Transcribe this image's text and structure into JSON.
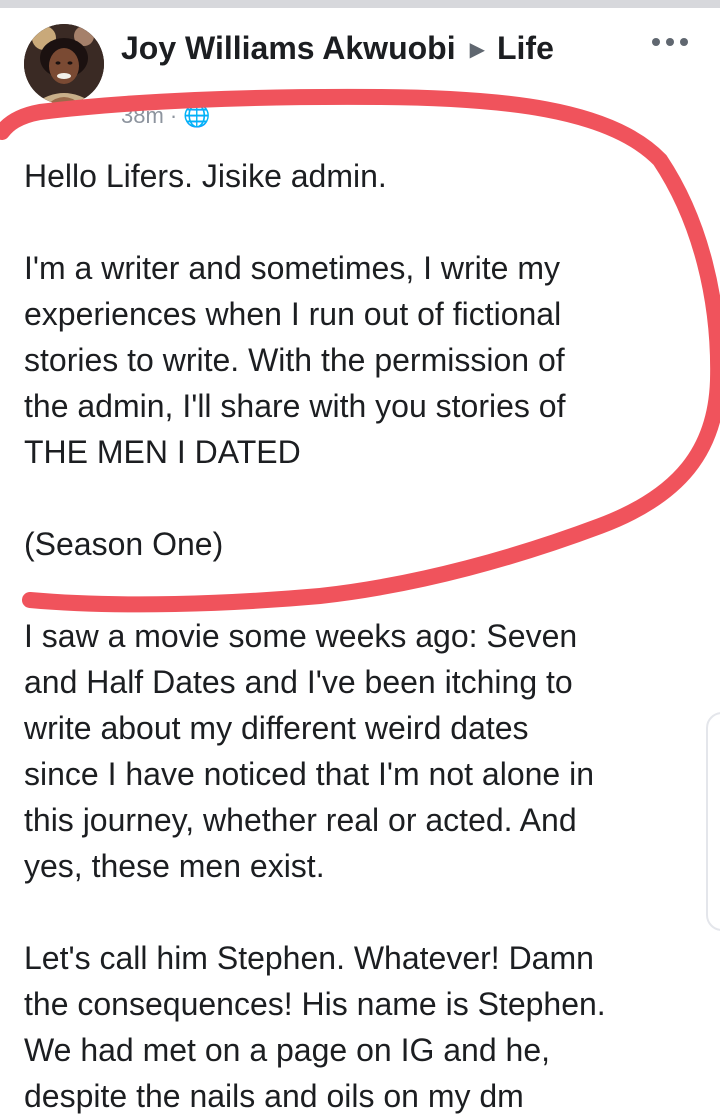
{
  "header": {
    "author_name": "Joy Williams Akwuobi",
    "separator_icon": "triangle-right-icon",
    "group_name": "Life",
    "more_icon": "more-horizontal-icon",
    "meta_text": "38m · 🌐"
  },
  "post": {
    "paragraphs": [
      "Hello Lifers. Jisike admin.",
      "I'm a writer and sometimes, I write my\nexperiences when I run out of fictional\nstories to write. With the permission of\nthe admin, I'll share with you stories of\nTHE MEN I DATED",
      "(Season One)",
      "I saw a movie some weeks ago: Seven\nand Half Dates and I've been itching to\nwrite about my different weird dates\nsince I have noticed that I'm not alone in\nthis journey, whether real or acted. And\nyes, these men exist.",
      "Let's call him Stephen. Whatever! Damn\nthe consequences! His name is Stephen.\nWe had met on a page on IG and he,\ndespite the nails and oils on my  dm"
    ]
  },
  "colors": {
    "annotation_stroke": "#f0535c",
    "text": "#1c1e21",
    "secondary_text": "#606770"
  }
}
